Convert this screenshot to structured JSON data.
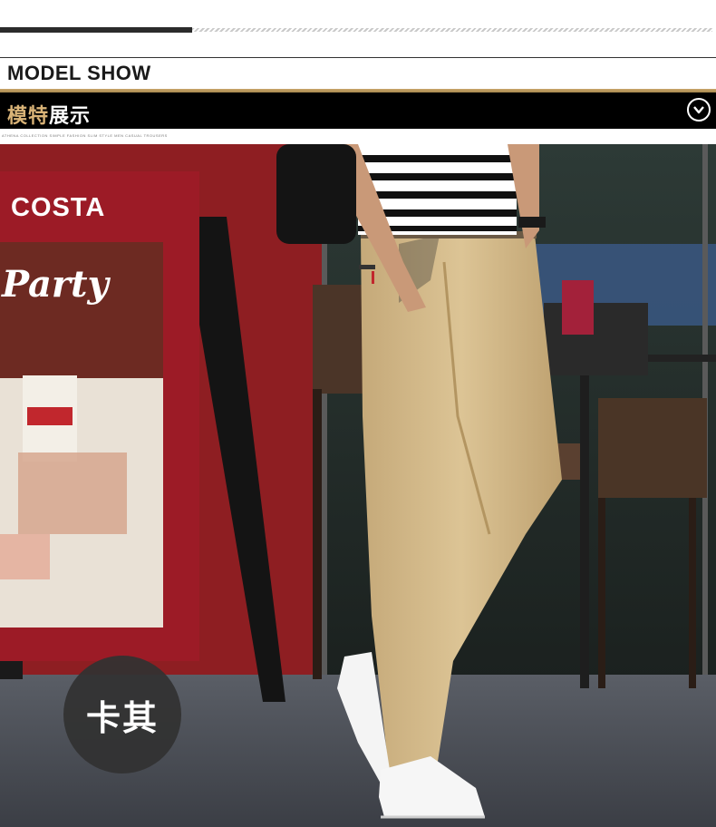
{
  "header": {
    "title_en": "MODEL SHOW",
    "title_cn_part1": "模特",
    "title_cn_part2": "展示",
    "tiny_text": "ATHENA COLLECTION SIMPLE FASHION SLIM STYLE MEN CASUAL TROUSERS"
  },
  "photo": {
    "sign_brand": "COSTA",
    "sign_party": "Party"
  },
  "color_badge": {
    "label": "卡其"
  },
  "colors": {
    "gold": "#d9b377",
    "black_bar": "#000000",
    "khaki": "#d2b98a",
    "badge_bg": "#323232"
  },
  "icons": {
    "toggle": "chevron-down-icon"
  }
}
